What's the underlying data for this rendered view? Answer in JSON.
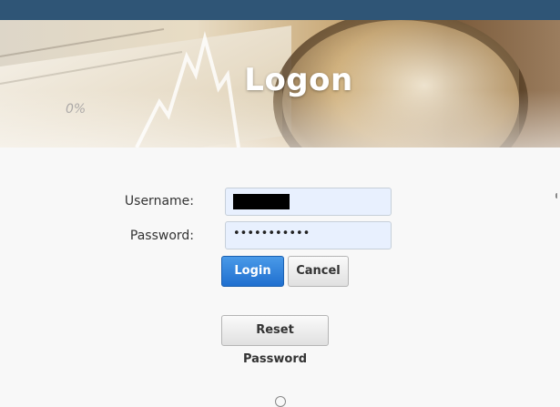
{
  "banner": {
    "title": "Logon"
  },
  "form": {
    "username_label": "Username:",
    "password_label": "Password:",
    "password_mask": "•••••••••••",
    "login_label": "Login",
    "cancel_label": "Cancel",
    "reset_label": "Reset Password"
  },
  "colors": {
    "top_bar": "#2f5576",
    "primary_button": "#2b7bd8",
    "input_background": "#e8f0fe"
  },
  "icons": {
    "banner": "finance-chart-magnifier-image"
  }
}
